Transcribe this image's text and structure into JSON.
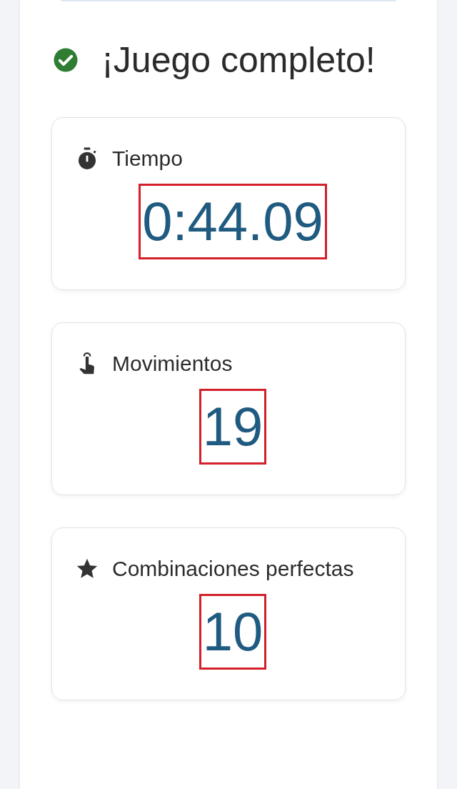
{
  "title": "¡Juego completo!",
  "stats": [
    {
      "kind": "time",
      "label": "Tiempo",
      "value": "0:44.09",
      "highlighted": true
    },
    {
      "kind": "moves",
      "label": "Movimientos",
      "value": "19",
      "highlighted": true
    },
    {
      "kind": "perfect",
      "label": "Combinaciones perfectas",
      "value": "10",
      "highlighted": true
    }
  ]
}
